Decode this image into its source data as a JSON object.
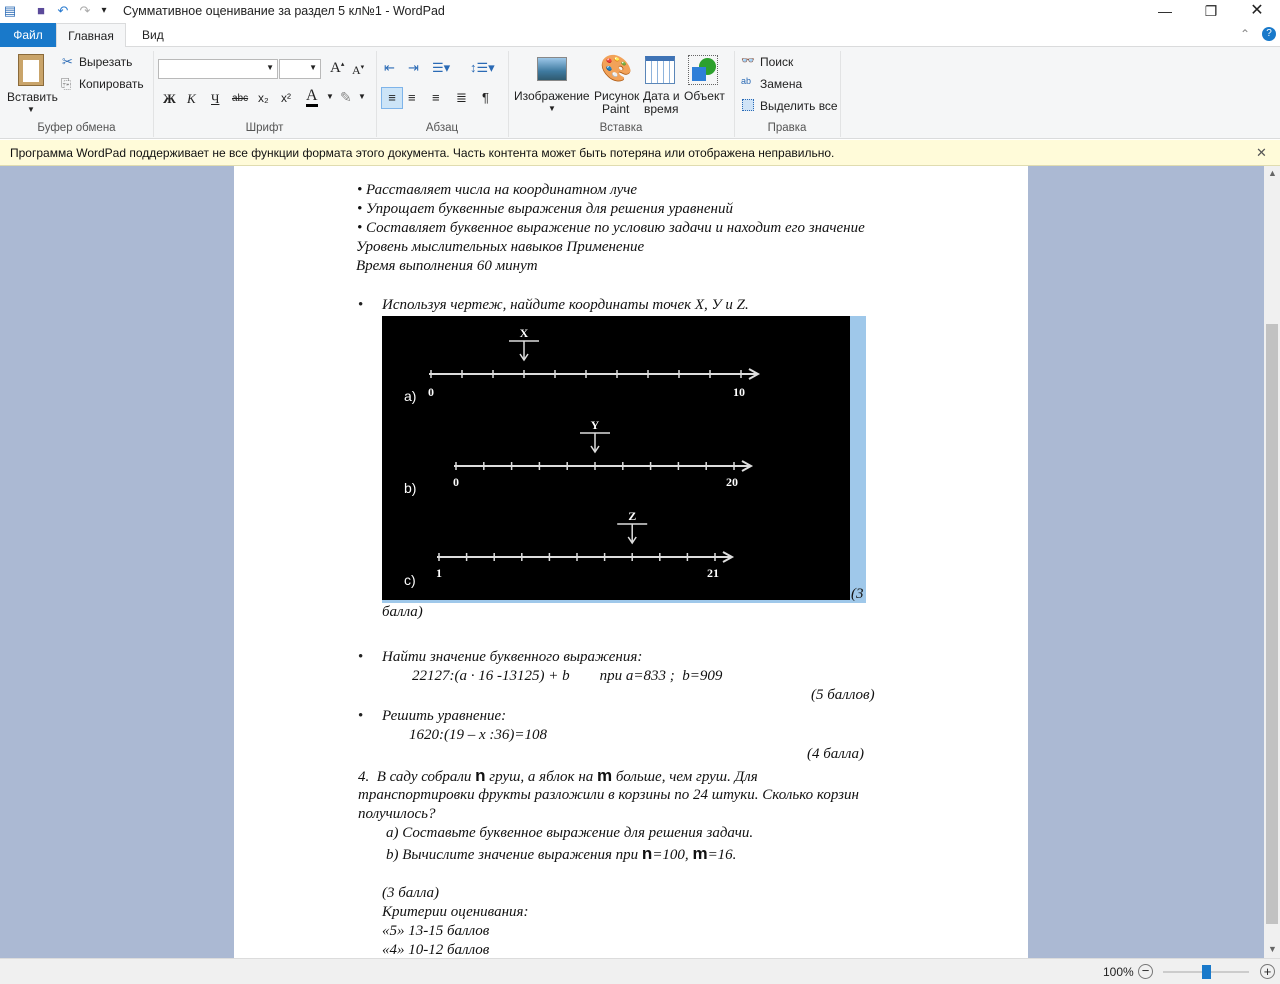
{
  "window": {
    "title": "Суммативное оценивание за раздел 5 кл№1 - WordPad"
  },
  "tabs": [
    {
      "label": "Файл"
    },
    {
      "label": "Главная"
    },
    {
      "label": "Вид"
    }
  ],
  "ribbon": {
    "clipboard": {
      "label": "Буфер обмена",
      "paste": "Вставить",
      "cut": "Вырезать",
      "copy": "Копировать"
    },
    "font": {
      "label": "Шрифт",
      "font_name": "",
      "font_size": "",
      "bold": "Ж",
      "italic": "К",
      "underline": "Ч",
      "strike": "abc",
      "sub": "x₂",
      "sup": "x²",
      "color": "A"
    },
    "paragraph": {
      "label": "Абзац"
    },
    "insert": {
      "label": "Вставка",
      "image": "Изображение",
      "paint1": "Рисунок",
      "paint2": "Paint",
      "date1": "Дата и",
      "date2": "время",
      "object": "Объект"
    },
    "edit": {
      "label": "Правка",
      "find": "Поиск",
      "replace": "Замена",
      "select_all": "Выделить все"
    }
  },
  "infobar": {
    "message": "Программа WordPad поддерживает не все функции формата этого документа. Часть контента может быть потеряна или отображена неправильно."
  },
  "document": {
    "lines": [
      "• Расставляет числа на координатном луче",
      "• Упрощает буквенные выражения для решения уравнений",
      "• Составляет буквенное выражение по условию задачи и находит его значение",
      "Уровень мыслительных навыков Применение",
      "Время выполнения 60 минут"
    ],
    "task1": "Используя чертеж, найдите координаты точек X, У и Z.",
    "task1_points_a": "(3",
    "task1_points_b": "балла)",
    "figure": {
      "lines": [
        {
          "label": "a)",
          "start": "0",
          "end": "10",
          "point": "X",
          "point_tick": 3
        },
        {
          "label": "b)",
          "start": "0",
          "end": "20",
          "point": "Y",
          "point_tick": 5
        },
        {
          "label": "c)",
          "start": "1",
          "end": "21",
          "point": "Z",
          "point_tick": 7
        }
      ]
    },
    "task2": "Найти значение буквенного выражения:",
    "task2_expr": "22127:(а · 16 -13125) + b        при а=833 ;  b=909",
    "task2_points": "(5 баллов)",
    "task3": "Решить уравнение:",
    "task3_expr": "1620:(19 – х :36)=108",
    "task3_points": "(4 балла)",
    "task4_l1a": "4.  В саду собрали ",
    "task4_n": "n",
    "task4_l1b": " груш, а яблок на ",
    "task4_m": "m",
    "task4_l1c": " больше, чем груш. Для",
    "task4_l2": "транспортировки фрукты разложили в корзины по 24 штуки. Сколько корзин",
    "task4_l3": "получилось?",
    "task4_a": "а) Составьте буквенное выражение для решения задачи.",
    "task4_b1": "b) Вычислите значение выражения при ",
    "task4_b_n": "n",
    "task4_b2": "=100, ",
    "task4_b_m": "m",
    "task4_b3": "=16.",
    "task4_points": "(3 балла)",
    "criteria": "Критерии оценивания:",
    "crit5": "«5» 13-15 баллов",
    "crit4": "«4» 10-12 баллов"
  },
  "status": {
    "zoom": "100%",
    "zoom_fraction": 0.5
  }
}
